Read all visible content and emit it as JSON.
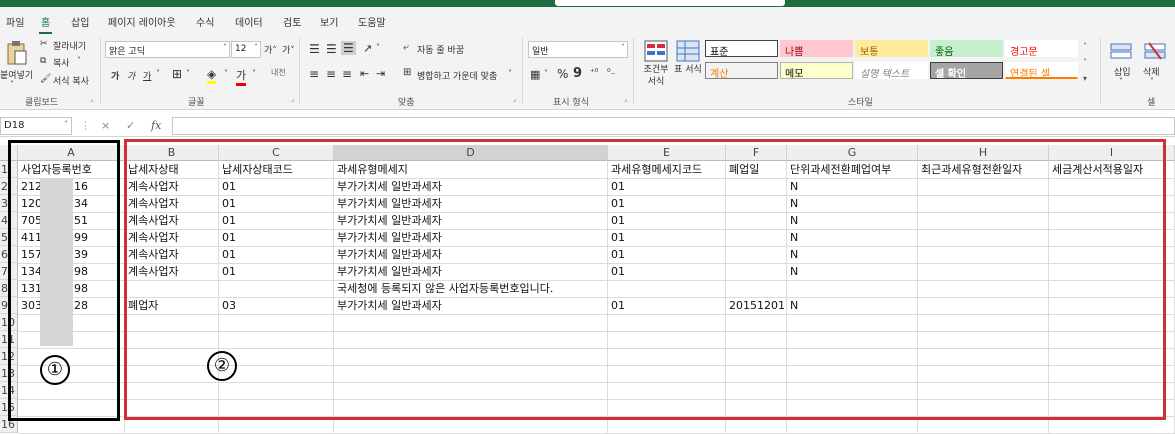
{
  "ribbon": {
    "tabs": [
      "파일",
      "홈",
      "삽입",
      "페이지 레이아웃",
      "수식",
      "데이터",
      "검토",
      "보기",
      "도움말"
    ],
    "clipboard": {
      "paste": "붙여넣기",
      "cut": "잘라내기",
      "copy": "복사",
      "format_painter": "서식 복사",
      "label": "클립보드"
    },
    "font": {
      "name": "맑은 고딕",
      "size": "12",
      "grow": "가˄",
      "shrink": "가˅",
      "bold": "가",
      "italic": "가",
      "underline": "가",
      "font_color_glyph": "가",
      "phonetic": "내천",
      "label": "글꼴"
    },
    "alignment": {
      "wrap": "자동 줄 바꿈",
      "merge": "병합하고 가운데 맞춤",
      "label": "맞춤"
    },
    "number": {
      "format": "일반",
      "percent": "%",
      "comma": "9",
      "label": "표시 형식"
    },
    "styles": {
      "conditional": "조건부 서식",
      "table": "표 서식",
      "cells": [
        {
          "text": "표준",
          "bg": "#ffffff",
          "color": "#000000",
          "border": "#444444"
        },
        {
          "text": "나쁨",
          "bg": "#ffc7ce",
          "color": "#9c0006",
          "border": "#ffc7ce"
        },
        {
          "text": "보통",
          "bg": "#ffeb9c",
          "color": "#9c5700",
          "border": "#ffeb9c"
        },
        {
          "text": "좋음",
          "bg": "#c6efce",
          "color": "#006100",
          "border": "#c6efce"
        },
        {
          "text": "경고문",
          "bg": "#ffffff",
          "color": "#ff0000",
          "border": "#ffffff"
        },
        {
          "text": "계산",
          "bg": "#f2f2f2",
          "color": "#fa7d00",
          "border": "#7f7f7f"
        },
        {
          "text": "메모",
          "bg": "#ffffcc",
          "color": "#000000",
          "border": "#b2b2b2"
        },
        {
          "text": "설명 텍스트",
          "bg": "#ffffff",
          "color": "#7f7f7f",
          "border": "#ffffff"
        },
        {
          "text": "셀 확인",
          "bg": "#a5a5a5",
          "color": "#ffffff",
          "border": "#3f3f3f"
        },
        {
          "text": "연결된 셀",
          "bg": "#ffffff",
          "color": "#fa7d00",
          "border": "#ffffff"
        }
      ],
      "label": "스타일"
    },
    "cells": {
      "insert": "삽입",
      "delete": "삭제",
      "label": "셀"
    }
  },
  "formula_bar": {
    "name_box": "D18",
    "fx": "fx",
    "cancel": "×",
    "enter": "✓",
    "value": ""
  },
  "sheet": {
    "columns": [
      "A",
      "B",
      "C",
      "D",
      "E",
      "F",
      "G",
      "H",
      "I"
    ],
    "row_numbers": [
      "1",
      "2",
      "3",
      "4",
      "5",
      "6",
      "7",
      "8",
      "9",
      "10",
      "11",
      "12",
      "13",
      "14",
      "15",
      "16"
    ],
    "headers": [
      "사업자등록번호",
      "납세자상태",
      "납세자상태코드",
      "과세유형메세지",
      "과세유형메세지코드",
      "폐업일",
      "단위과세전환폐업여부",
      "최근과세유형전환일자",
      "세금계산서적용일자"
    ],
    "rows": [
      [
        "212",
        "16",
        "계속사업자",
        "01",
        "부가가치세 일반과세자",
        "01",
        "",
        "N",
        "",
        ""
      ],
      [
        "120",
        "34",
        "계속사업자",
        "01",
        "부가가치세 일반과세자",
        "01",
        "",
        "N",
        "",
        ""
      ],
      [
        "705",
        "51",
        "계속사업자",
        "01",
        "부가가치세 일반과세자",
        "01",
        "",
        "N",
        "",
        ""
      ],
      [
        "411",
        "99",
        "계속사업자",
        "01",
        "부가가치세 일반과세자",
        "01",
        "",
        "N",
        "",
        ""
      ],
      [
        "157",
        "39",
        "계속사업자",
        "01",
        "부가가치세 일반과세자",
        "01",
        "",
        "N",
        "",
        ""
      ],
      [
        "134",
        "98",
        "계속사업자",
        "01",
        "부가가치세 일반과세자",
        "01",
        "",
        "N",
        "",
        ""
      ],
      [
        "131",
        "98",
        "",
        "",
        "국세청에 등록되지 않은 사업자등록번호입니다.",
        "",
        "",
        "",
        "",
        ""
      ],
      [
        "303",
        "28",
        "폐업자",
        "03",
        "부가가치세 일반과세자",
        "01",
        "20151201",
        "N",
        "",
        ""
      ]
    ]
  },
  "annotations": {
    "label_1": "①",
    "label_2": "②",
    "box1_color": "#000000",
    "box2_color": "#d22d39"
  }
}
